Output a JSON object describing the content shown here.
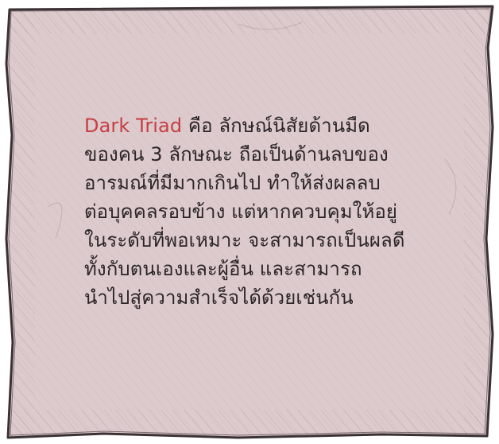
{
  "note": {
    "highlight": "Dark Triad",
    "lines": [
      " คือ ลักษณ์นิสัยด้านมืด",
      "ของคน 3 ลักษณะ ถือเป็นด้านลบของ",
      "อารมณ์ที่มีมากเกินไป ทำให้ส่งผลลบ",
      "ต่อบุคคลรอบข้าง แต่หากควบคุมให้อยู่",
      "ในระดับที่พอเหมาะ จะสามารถเป็นผลดี",
      "ทั้งกับตนเองและผู้อื่น และสามารถ",
      "นำไปสู่ความสำเร็จได้ด้วยเช่นกัน"
    ]
  },
  "colors": {
    "paper": "#d8c3c6",
    "paper_edge": "#3a3133",
    "text": "#2b2526",
    "highlight": "#c63f43"
  }
}
